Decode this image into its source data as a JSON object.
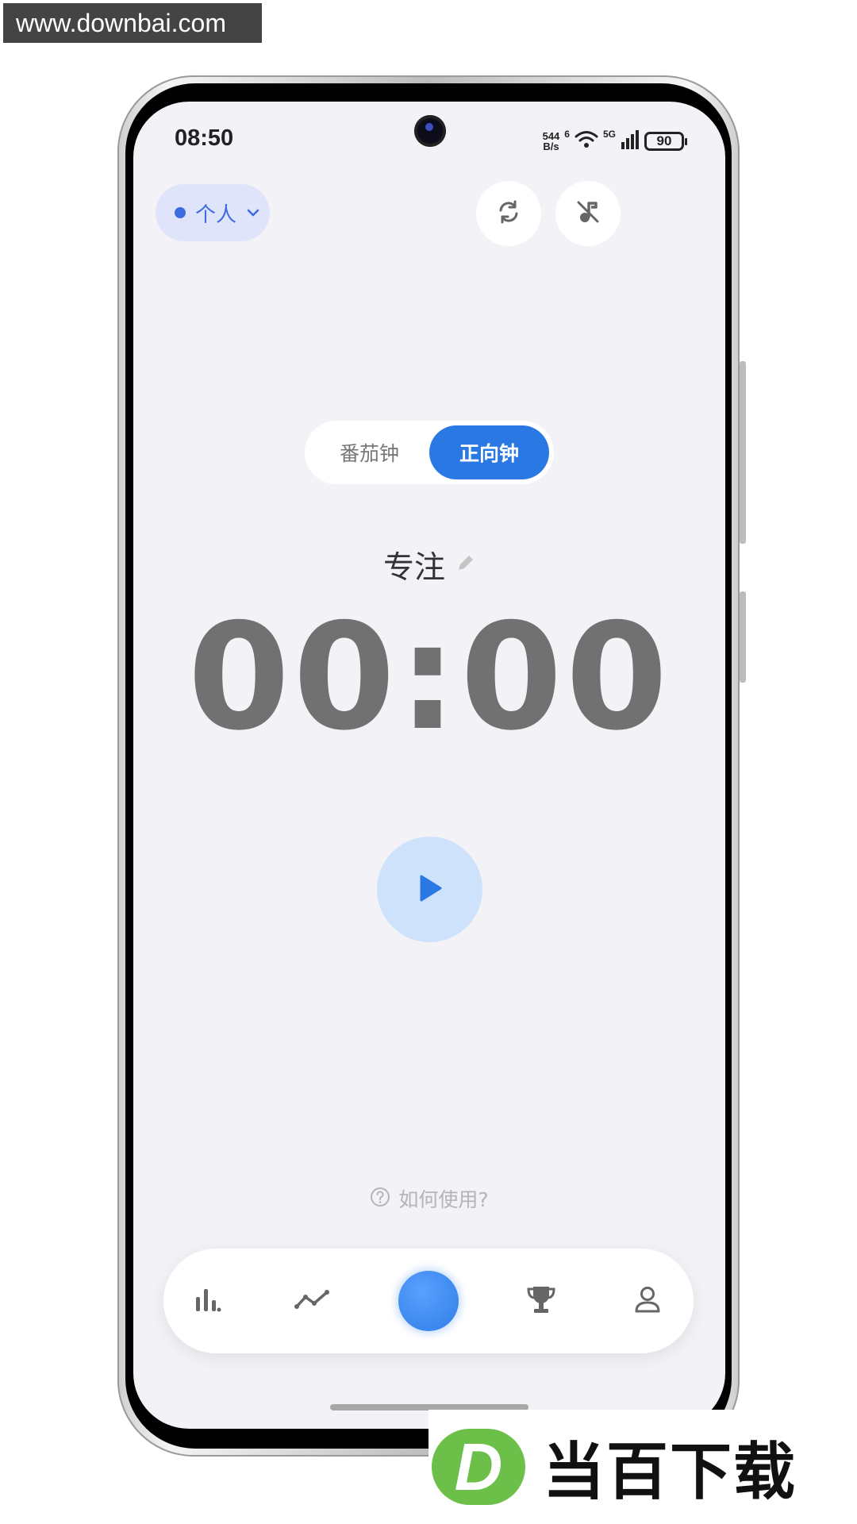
{
  "watermark": {
    "site": "www.downbai.com",
    "brand_letter": "D",
    "brand_text": "当百下载"
  },
  "status_bar": {
    "time": "08:50",
    "net_speed_value": "544",
    "net_speed_unit": "B/s",
    "wifi_label": "6",
    "cell_label": "5G",
    "battery": "90"
  },
  "header": {
    "profile_label": "个人",
    "sync_icon": "sync-icon",
    "mute_icon": "music-off-icon"
  },
  "mode_toggle": {
    "options": [
      "番茄钟",
      "正向钟"
    ],
    "selected": "正向钟"
  },
  "timer": {
    "label": "专注",
    "value": "00:00"
  },
  "help": {
    "text": "如何使用?"
  },
  "bottom_nav": {
    "items": [
      "stats-bar-icon",
      "trend-line-icon",
      "focus-center",
      "trophy-icon",
      "profile-icon"
    ]
  },
  "colors": {
    "accent": "#2a78e4",
    "background": "#f2f2f7",
    "chip_bg": "#dfe4fa",
    "play_bg": "#cfe2fc",
    "timer_text": "#717171"
  }
}
